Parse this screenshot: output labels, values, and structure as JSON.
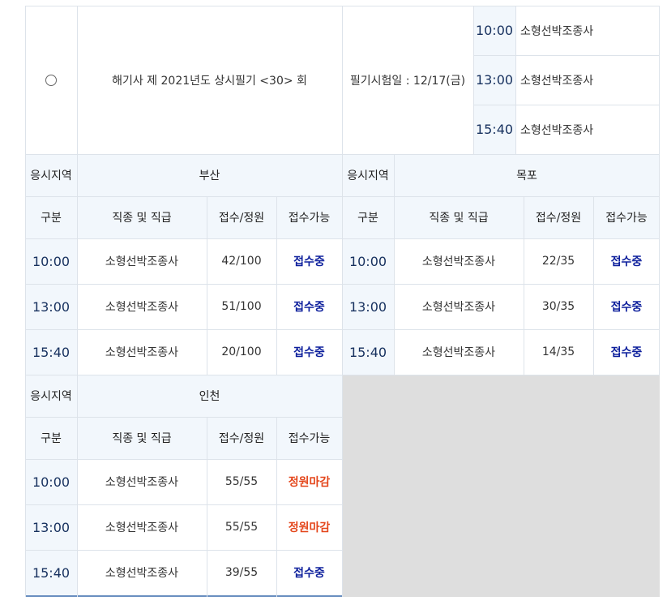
{
  "exam": {
    "title": "해기사 제 2021년도 상시필기 <30> 회",
    "date_label": "필기시험일 : 12/17(금)",
    "times": [
      "10:00",
      "13:00",
      "15:40"
    ],
    "job": "소형선박조종사"
  },
  "headers": {
    "region_label": "응시지역",
    "col_time": "구분",
    "col_job": "직종 및 직급",
    "col_count": "접수/정원",
    "col_status": "접수가능"
  },
  "regions": [
    {
      "name": "부산",
      "rows": [
        {
          "time": "10:00",
          "job": "소형선박조종사",
          "count": "42/100",
          "status": "접수중",
          "state": "open"
        },
        {
          "time": "13:00",
          "job": "소형선박조종사",
          "count": "51/100",
          "status": "접수중",
          "state": "open"
        },
        {
          "time": "15:40",
          "job": "소형선박조종사",
          "count": "20/100",
          "status": "접수중",
          "state": "open"
        }
      ]
    },
    {
      "name": "목포",
      "rows": [
        {
          "time": "10:00",
          "job": "소형선박조종사",
          "count": "22/35",
          "status": "접수중",
          "state": "open"
        },
        {
          "time": "13:00",
          "job": "소형선박조종사",
          "count": "30/35",
          "status": "접수중",
          "state": "open"
        },
        {
          "time": "15:40",
          "job": "소형선박조종사",
          "count": "14/35",
          "status": "접수중",
          "state": "open"
        }
      ]
    },
    {
      "name": "인천",
      "rows": [
        {
          "time": "10:00",
          "job": "소형선박조종사",
          "count": "55/55",
          "status": "정원마감",
          "state": "closed"
        },
        {
          "time": "13:00",
          "job": "소형선박조종사",
          "count": "55/55",
          "status": "정원마감",
          "state": "closed"
        },
        {
          "time": "15:40",
          "job": "소형선박조종사",
          "count": "39/55",
          "status": "접수중",
          "state": "open"
        }
      ]
    }
  ],
  "colors": {
    "header_bg": "#f2f7fc",
    "open": "#0d1f9c",
    "closed": "#e4461b",
    "empty_bg": "#dedede",
    "border": "#dde3ea"
  }
}
